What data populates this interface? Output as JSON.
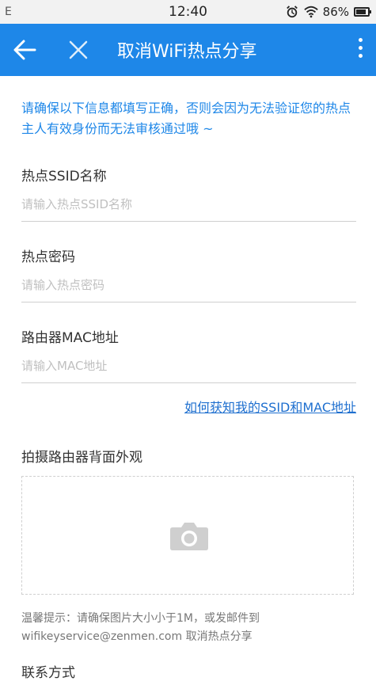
{
  "status_bar": {
    "carrier": "E",
    "time": "12:40",
    "battery": "86%",
    "battery_level": 0.86,
    "icons": [
      "alarm-icon",
      "wifi-icon",
      "battery-icon"
    ]
  },
  "header": {
    "title": "取消WiFi热点分享",
    "background_color": "#1e87e8",
    "icons": [
      "back-arrow-icon",
      "close-icon",
      "more-vertical-icon"
    ]
  },
  "notice": "请确保以下信息都填写正确，否则会因为无法验证您的热点主人有效身份而无法审核通过哦 ~",
  "fields": [
    {
      "label": "热点SSID名称",
      "value": "",
      "placeholder": "请输入热点SSID名称"
    },
    {
      "label": "热点密码",
      "value": "",
      "placeholder": "请输入热点密码"
    },
    {
      "label": "路由器MAC地址",
      "value": "",
      "placeholder": "请输入MAC地址"
    }
  ],
  "help_link": "如何获知我的SSID和MAC地址",
  "photo": {
    "label": "拍摄路由器背面外观",
    "icon": "camera-icon"
  },
  "tip": {
    "line1": "温馨提示：请确保图片大小小于1M，或发邮件到",
    "line2": "wifikeyservice@zenmen.com 取消热点分享"
  },
  "bottom_partial": "联系方式",
  "accent_color": "#1e87e8"
}
